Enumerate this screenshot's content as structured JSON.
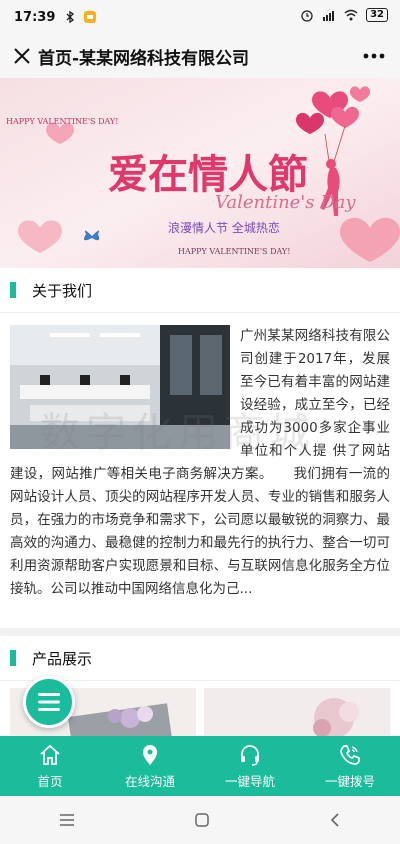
{
  "status_bar": {
    "time": "17:39",
    "signal": "4G",
    "battery": "32"
  },
  "header": {
    "title": "首页-某某网络科技有限公司"
  },
  "banner": {
    "tag": "HAPPY VALENTINE'S DAY!",
    "headline": "爱在情人節",
    "script_title": "Valentine's Day",
    "slogan": "浪漫情人节 全城热恋",
    "bottom_text": "HAPPY VALENTINE'S DAY!"
  },
  "about": {
    "title": "关于我们",
    "text": "广州某某网络科技有限公司创建于2017年，发展至今已有着丰富的网站建设经验，成立至今，已经成功为3000多家企事业单位和个人提 供了网站建设，网站推广等相关电子商务解决方案。　　我们拥有一流的网站设计人员、顶尖的网站程序开发人员、专业的销售和服务人员，在强力的市场竞争和需求下，公司愿以最敏锐的洞察力、最高效的沟通力、最稳健的控制力和最先行的执行力、整合一切可利用资源帮助客户实现愿景和目标、与互联网信息化服务全方位接轨。公司以推动中国网络信息化为己..."
  },
  "watermark": "数字化用商城",
  "products": {
    "title": "产品展示"
  },
  "tabbar": [
    {
      "label": "首页",
      "icon": "home-icon"
    },
    {
      "label": "在线沟通",
      "icon": "location-pin-icon"
    },
    {
      "label": "一键导航",
      "icon": "headset-icon"
    },
    {
      "label": "一键拨号",
      "icon": "phone-icon"
    }
  ],
  "colors": {
    "accent": "#1bbc9b",
    "banner_pink": "#e94b7a"
  }
}
